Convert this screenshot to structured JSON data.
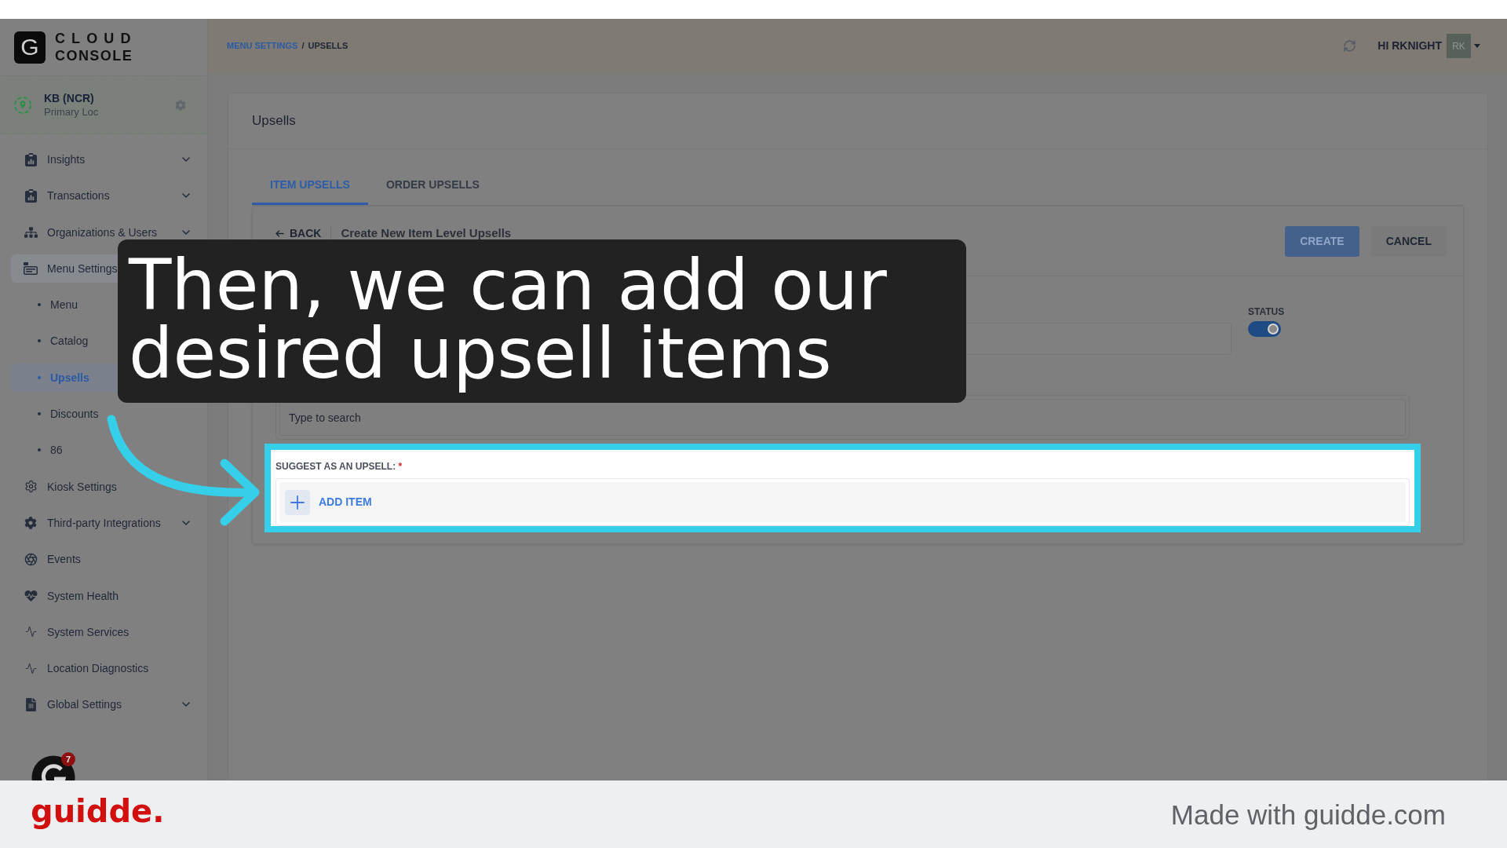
{
  "logo": {
    "letter": "G",
    "lines": [
      "CLOUD",
      "CONSOLE"
    ]
  },
  "location": {
    "name": "KB (NCR)",
    "subtitle": "Primary Loc"
  },
  "sidebar": {
    "items": [
      {
        "label": "Insights",
        "kind": "group",
        "expanded": false,
        "selected": false
      },
      {
        "label": "Transactions",
        "kind": "group",
        "expanded": false,
        "selected": false
      },
      {
        "label": "Organizations & Users",
        "kind": "group",
        "expanded": false,
        "selected": false
      },
      {
        "label": "Menu Settings",
        "kind": "group",
        "expanded": true,
        "selected": true,
        "children": [
          {
            "label": "Menu",
            "selected": false
          },
          {
            "label": "Catalog",
            "selected": false
          },
          {
            "label": "Upsells",
            "selected": true
          },
          {
            "label": "Discounts",
            "selected": false
          },
          {
            "label": "86",
            "selected": false
          }
        ]
      },
      {
        "label": "Kiosk Settings",
        "kind": "link",
        "selected": false
      },
      {
        "label": "Third-party Integrations",
        "kind": "group",
        "expanded": false,
        "selected": false
      },
      {
        "label": "Events",
        "kind": "link",
        "selected": false
      },
      {
        "label": "System Health",
        "kind": "link",
        "selected": false
      },
      {
        "label": "System Services",
        "kind": "link",
        "selected": false
      },
      {
        "label": "Location Diagnostics",
        "kind": "link",
        "selected": false
      },
      {
        "label": "Global Settings",
        "kind": "group",
        "expanded": false,
        "selected": false
      }
    ]
  },
  "help_widget": {
    "badge": "7"
  },
  "breadcrumb": {
    "items": [
      {
        "label": "MENU SETTINGS",
        "kind": "link"
      },
      {
        "label": "UPSELLS",
        "kind": "current"
      }
    ],
    "separator": "/"
  },
  "user": {
    "greeting": "HI RKNIGHT",
    "initials": "RK"
  },
  "page": {
    "title": "Upsells",
    "tabs": [
      {
        "label": "ITEM UPSELLS",
        "selected": true
      },
      {
        "label": "ORDER UPSELLS",
        "selected": false
      }
    ],
    "form": {
      "back": "BACK",
      "title": "Create New Item Level Upsells",
      "buttons": [
        {
          "label": "CREATE",
          "kind": "primary"
        },
        {
          "label": "CANCEL",
          "kind": "secondary"
        }
      ],
      "status": {
        "label": "STATUS",
        "on": true
      },
      "trigger_field": {
        "placeholder": "Type to search"
      },
      "upsell_field": {
        "label": "SUGGEST AS AN UPSELL:",
        "required_mark": "*",
        "add_label": "ADD ITEM",
        "highlighted": true
      }
    }
  },
  "caption": {
    "text": "Then, we can add our desired upsell items"
  },
  "footer": {
    "brand": "guidde.",
    "credit": "Made with guidde.com"
  }
}
